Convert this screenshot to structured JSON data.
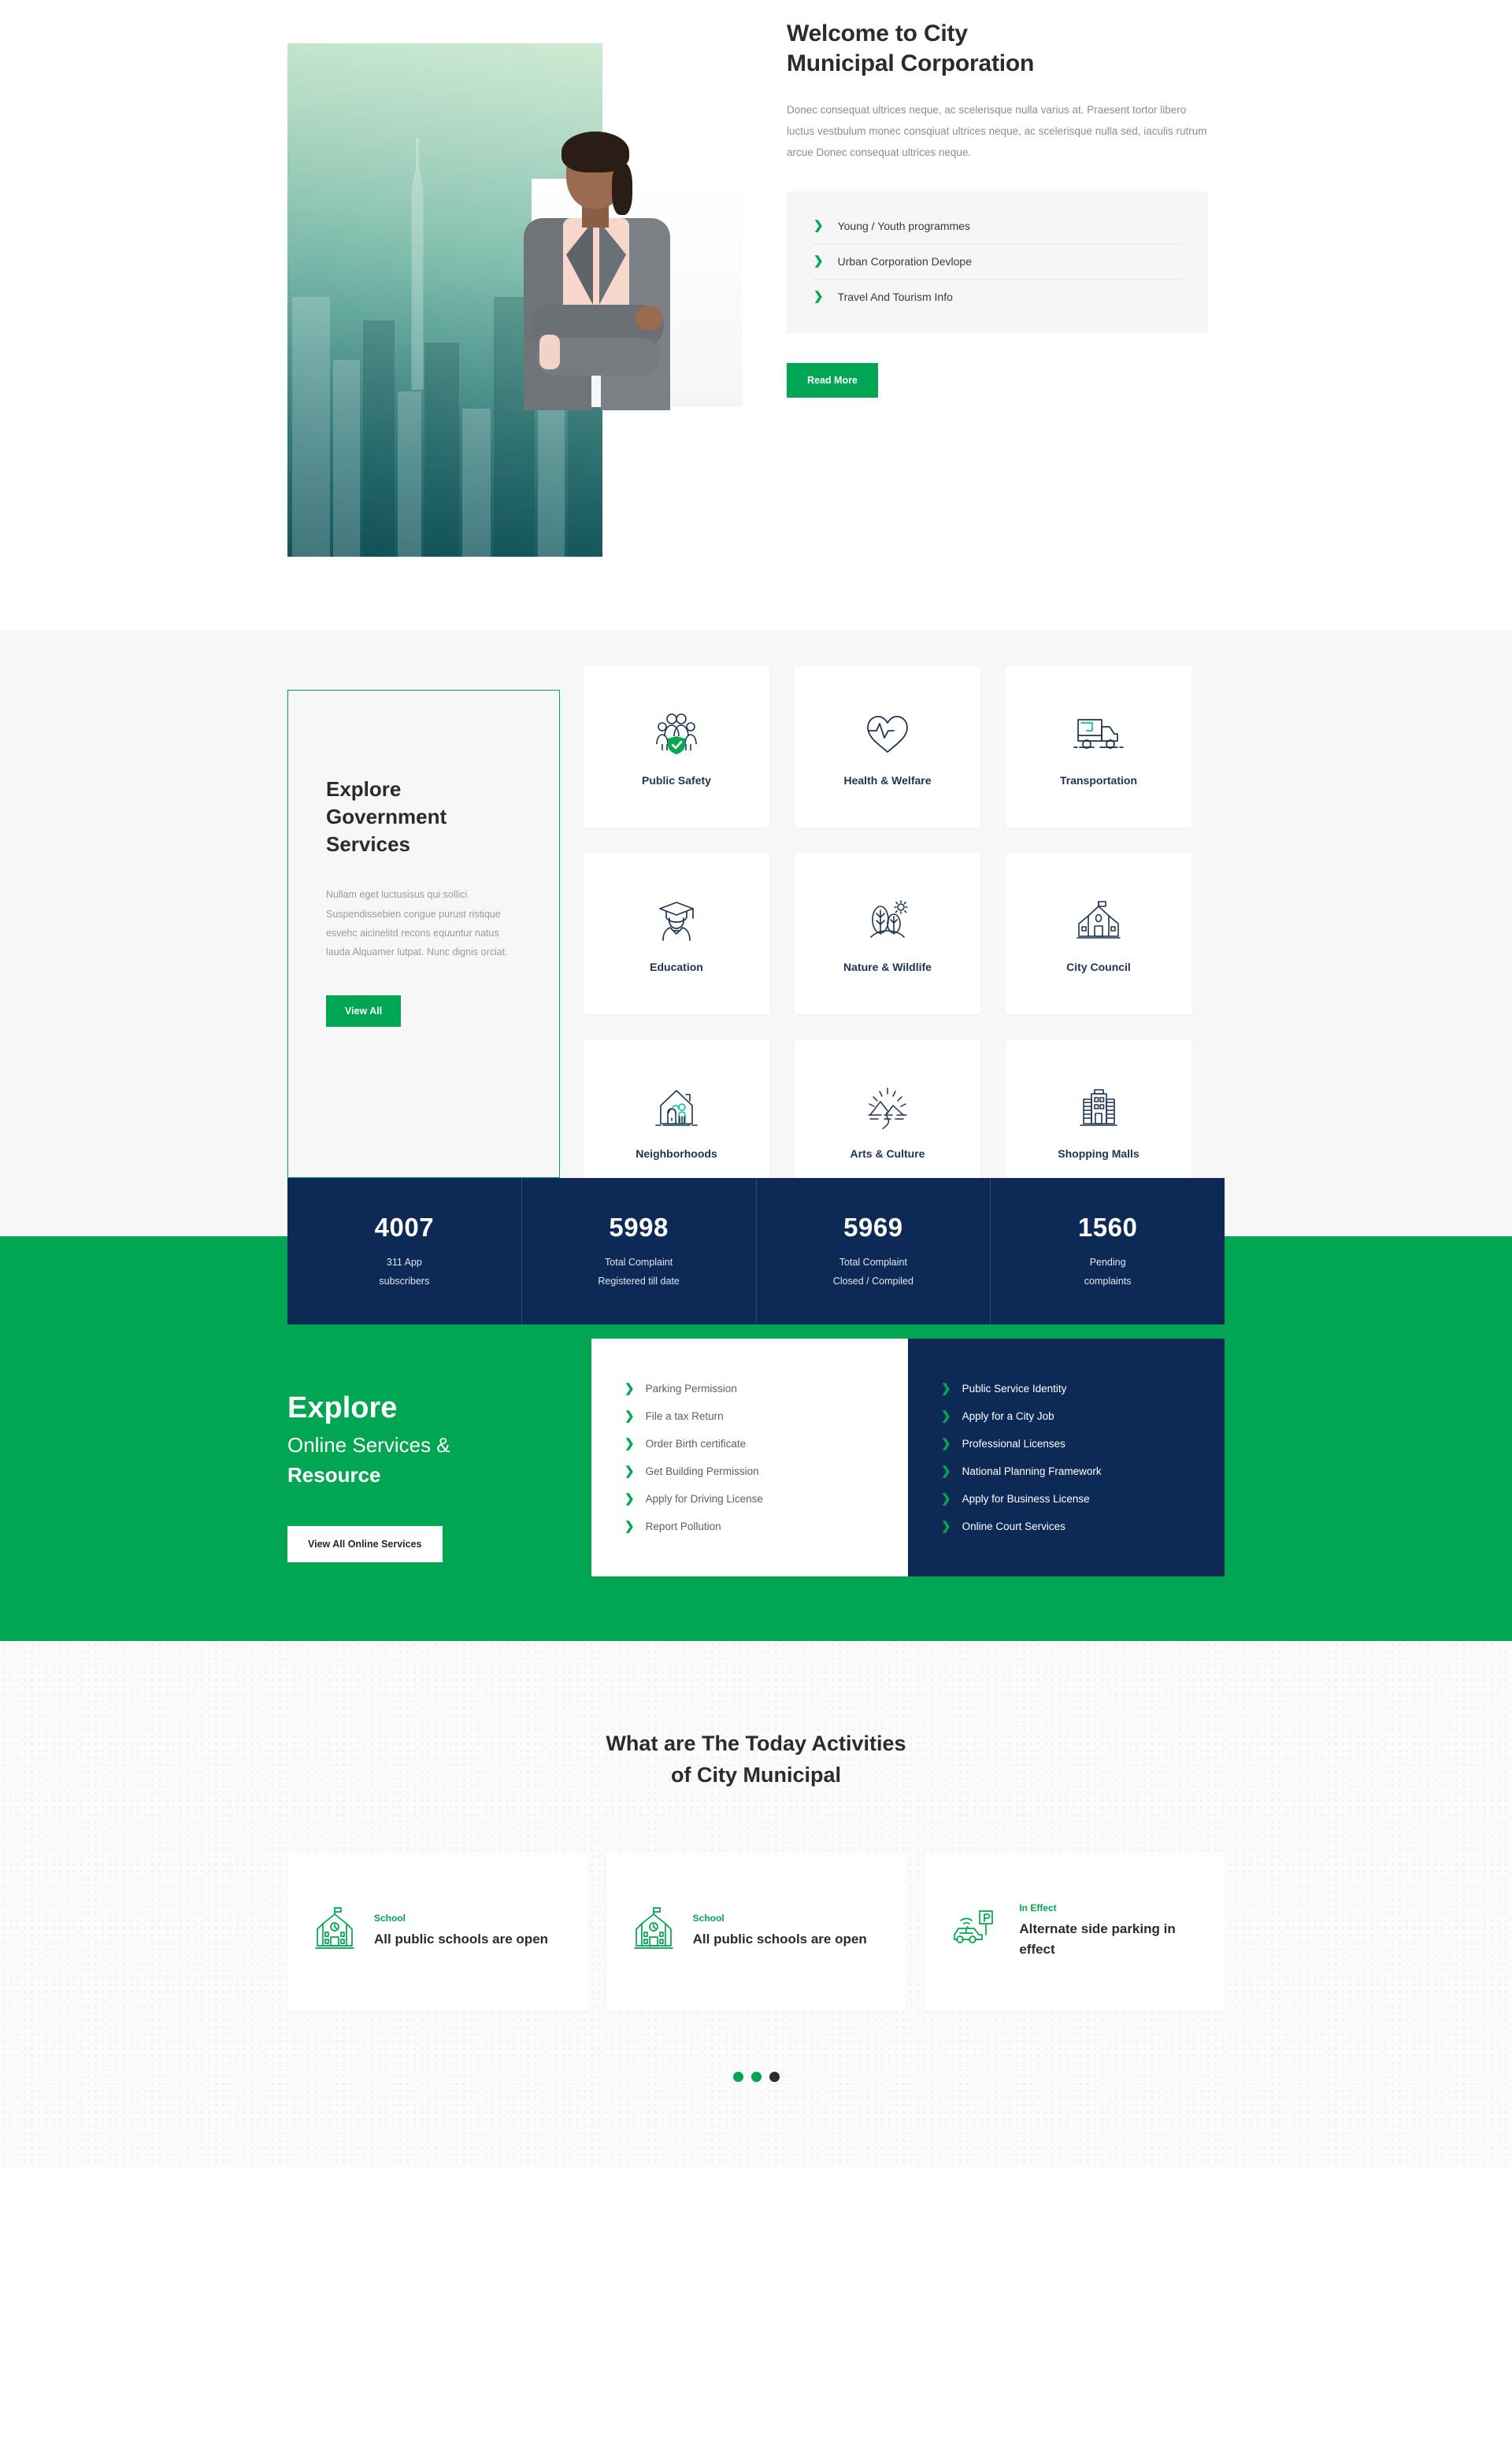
{
  "hero": {
    "title": "Welcome to City Municipal Corporation",
    "paragraph": "Donec consequat ultrices neque, ac scelerisque nulla varius at. Praesent tortor libero luctus vestbulum monec consqiuat ultrices neque, ac scelerisque nulla sed, iaculis rutrum arcue Donec consequat ultrices neque.",
    "list": [
      {
        "label": "Young / Youth programmes"
      },
      {
        "label": "Urban Corporation Devlope"
      },
      {
        "label": "Travel And Tourism Info"
      }
    ],
    "cta": "Read More",
    "image_alt": "city-skyline-photo",
    "portrait_alt": "businesswoman-portrait"
  },
  "services": {
    "title": "Explore Government Services",
    "paragraph": "Nullam eget luctusisus qui sollici Suspendissebien congue purust ristique esvehc aicinelitd recons equuntur natus lauda Alquamer lutpat. Nunc dignis orciat.",
    "cta": "View All",
    "items": [
      {
        "label": "Public Safety",
        "icon": "people-shield-icon"
      },
      {
        "label": "Health & Welfare",
        "icon": "heart-pulse-icon"
      },
      {
        "label": "Transportation",
        "icon": "delivery-truck-icon"
      },
      {
        "label": "Education",
        "icon": "graduate-icon"
      },
      {
        "label": "Nature & Wildlife",
        "icon": "trees-sun-icon"
      },
      {
        "label": "City Council",
        "icon": "civic-building-icon"
      },
      {
        "label": "Neighborhoods",
        "icon": "house-people-icon"
      },
      {
        "label": "Arts & Culture",
        "icon": "mountain-sunrise-icon"
      },
      {
        "label": "Shopping Malls",
        "icon": "mall-tower-icon"
      }
    ]
  },
  "stats": [
    {
      "number": "4007",
      "label": "311 App\nsubscribers",
      "l1": "311 App",
      "l2": "subscribers"
    },
    {
      "number": "5998",
      "label": "Total Complaint Registered till date",
      "l1": "Total Complaint",
      "l2": "Registered till date"
    },
    {
      "number": "5969",
      "label": "Total Complaint Closed / Compiled",
      "l1": "Total Complaint",
      "l2": "Closed / Compiled"
    },
    {
      "number": "1560",
      "label": "Pending complaints",
      "l1": "Pending",
      "l2": "complaints"
    }
  ],
  "online": {
    "heading_bold": "Explore",
    "heading_light": "Online Services &",
    "heading_bold2": "Resource",
    "cta": "View All Online Services",
    "left_list": [
      {
        "label": "Parking Permission"
      },
      {
        "label": "File a tax Return"
      },
      {
        "label": "Order Birth certificate"
      },
      {
        "label": "Get Building Permission"
      },
      {
        "label": "Apply for Driving License"
      },
      {
        "label": "Report Pollution"
      }
    ],
    "right_list": [
      {
        "label": "Public Service Identity"
      },
      {
        "label": "Apply for a City Job"
      },
      {
        "label": "Professional Licenses"
      },
      {
        "label": "National Planning Framework"
      },
      {
        "label": "Apply for Business License"
      },
      {
        "label": "Online Court Services"
      }
    ]
  },
  "activities": {
    "heading_line1": "What are The Today Activities",
    "heading_line2": "of City Municipal",
    "cards": [
      {
        "category": "School",
        "title": "All public schools are open",
        "icon": "school-building-icon"
      },
      {
        "category": "School",
        "title": "All public schools are open",
        "icon": "school-building-icon"
      },
      {
        "category": "In Effect",
        "title": "Alternate side parking in effect",
        "icon": "smart-parking-car-icon"
      }
    ],
    "carousel_dots": 3,
    "active_dot_index": 2
  },
  "colors": {
    "green": "#00a651",
    "navy": "#0c2a55",
    "grey_bg": "#f7f7f7",
    "text_dark": "#2b2b2b",
    "text_muted": "#8d8d8d",
    "teal_accent": "#00c2a8"
  }
}
